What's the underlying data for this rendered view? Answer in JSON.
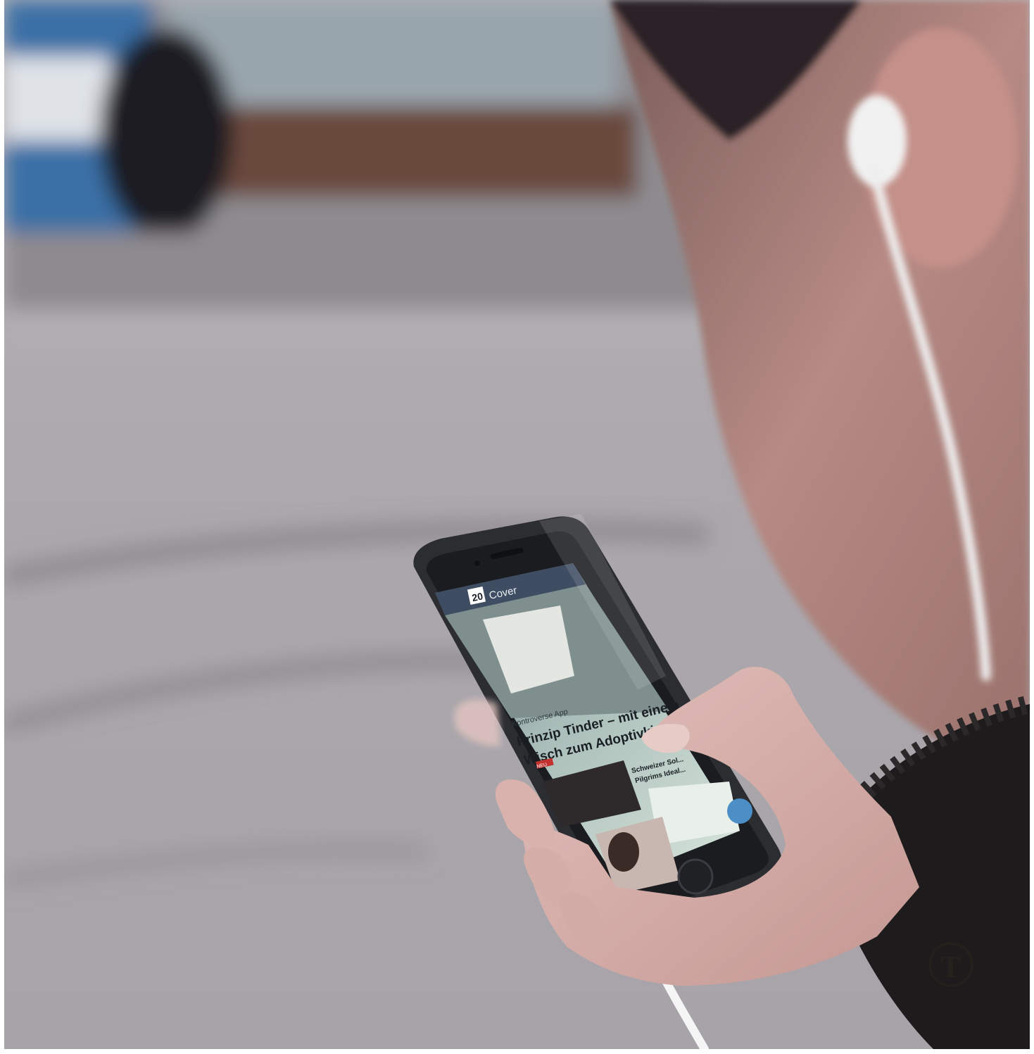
{
  "photo": {
    "subject": "person with white earphones reading a news app on a smartphone",
    "colors": {
      "pavement": "#a9a6ab",
      "tram_blue": "#3a6fa6",
      "phone_frame": "#2b2d31",
      "screen_tint": "#cfe0d6",
      "skin": "#c99a92",
      "sweater": "#1d1b1c",
      "earphone": "#eeeeee"
    }
  },
  "phone_screen": {
    "header_logo": "20",
    "header_label": "Cover",
    "kicker": "Kontroverse App",
    "headline_line1": "Prinzip Tinder – mit einem",
    "headline_line2": "Wisch zum Adoptivkind",
    "badge": "NEU",
    "side_headline_line1": "Schweizer Sol...",
    "side_headline_line2": "Pilgrims Ideal..."
  },
  "watermark": {
    "icon": "newspaper-t-logo",
    "text": "T"
  }
}
